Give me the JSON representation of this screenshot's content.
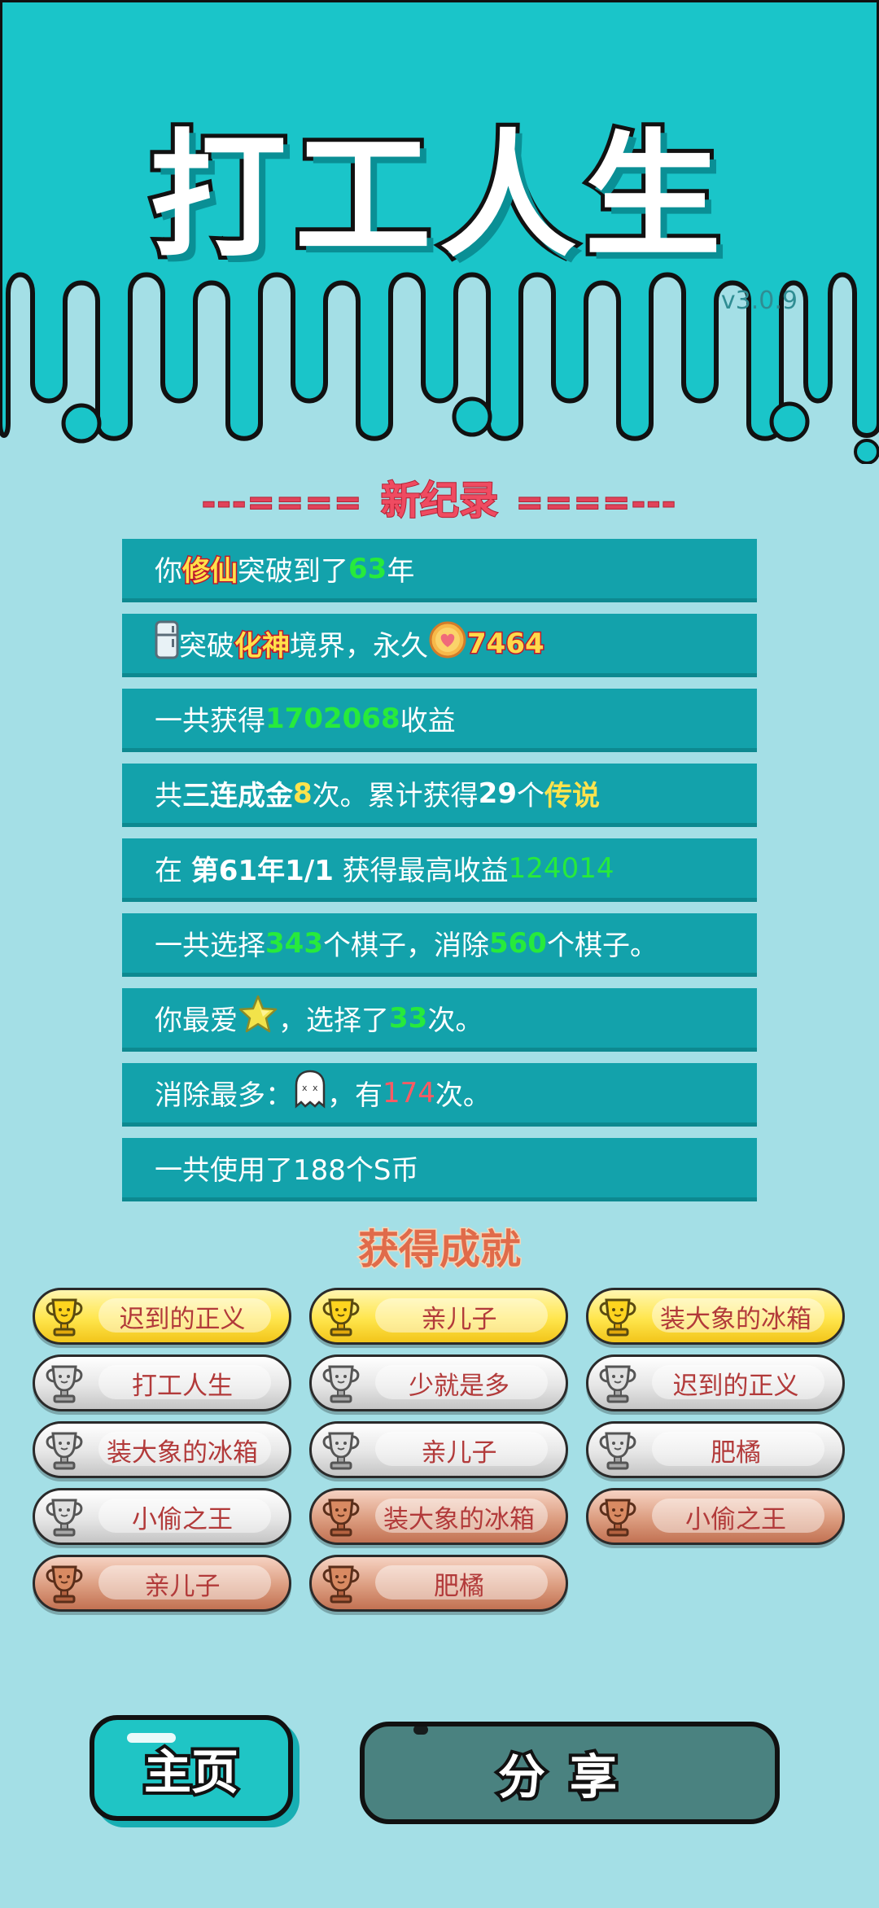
{
  "app": {
    "title": "打工人生",
    "version": "v3.0.9"
  },
  "record": {
    "heading_left": "---====",
    "heading": "新纪录",
    "heading_right": "====---",
    "rows": [
      {
        "p1": "你",
        "h1": "修仙",
        "p2": "突破到了",
        "v": "63",
        "p3": "年"
      },
      {
        "p1": "突破",
        "h1": "化神",
        "p2": "境界，永久",
        "v": "7464"
      },
      {
        "p1": "一共获得",
        "v": "1702068",
        "p2": "收益"
      },
      {
        "p1": "共",
        "b1": "三连成金",
        "v": "8",
        "p2": "次。累计获得",
        "b2": "29",
        "p3": "个",
        "y2": "传说"
      },
      {
        "p1": "在 ",
        "b1": "第61年1/1",
        "p2": " 获得最高收益",
        "v": "124014"
      },
      {
        "p1": "一共选择",
        "v": "343",
        "p2": "个棋子，消除",
        "v2": "560",
        "p3": "个棋子。"
      },
      {
        "p1": "你最爱",
        "p2": "，选择了",
        "v": "33",
        "p3": "次。"
      },
      {
        "p1": "消除最多：",
        "p2": "，有",
        "v": "174",
        "p3": "次。"
      },
      {
        "p1": "一共使用了188个S币"
      }
    ]
  },
  "achievements": {
    "title": "获得成就",
    "badges": [
      {
        "label": "迟到的正义",
        "tier": "gold"
      },
      {
        "label": "亲儿子",
        "tier": "gold"
      },
      {
        "label": "装大象的冰箱",
        "tier": "gold"
      },
      {
        "label": "打工人生",
        "tier": "silver"
      },
      {
        "label": "少就是多",
        "tier": "silver"
      },
      {
        "label": "迟到的正义",
        "tier": "silver"
      },
      {
        "label": "装大象的冰箱",
        "tier": "silver"
      },
      {
        "label": "亲儿子",
        "tier": "silver"
      },
      {
        "label": "肥橘",
        "tier": "silver"
      },
      {
        "label": "小偷之王",
        "tier": "silver"
      },
      {
        "label": "装大象的冰箱",
        "tier": "bronze"
      },
      {
        "label": "小偷之王",
        "tier": "bronze"
      },
      {
        "label": "亲儿子",
        "tier": "bronze"
      },
      {
        "label": "肥橘",
        "tier": "bronze"
      }
    ]
  },
  "buttons": {
    "home": "主页",
    "share": "分享"
  },
  "colors": {
    "header_bg": "#1ac5c9",
    "page_bg": "#a4dfe6",
    "row_bg": "#13a2ab",
    "highlight_green": "#27ea3c",
    "highlight_red": "#ff5a63",
    "highlight_yellow": "#ffe34d"
  },
  "icons": {
    "row2": "fridge-icon",
    "row2_coin": "heart-coin-icon",
    "row7": "star-icon",
    "row8": "ghost-icon",
    "badge": "trophy-icon"
  }
}
